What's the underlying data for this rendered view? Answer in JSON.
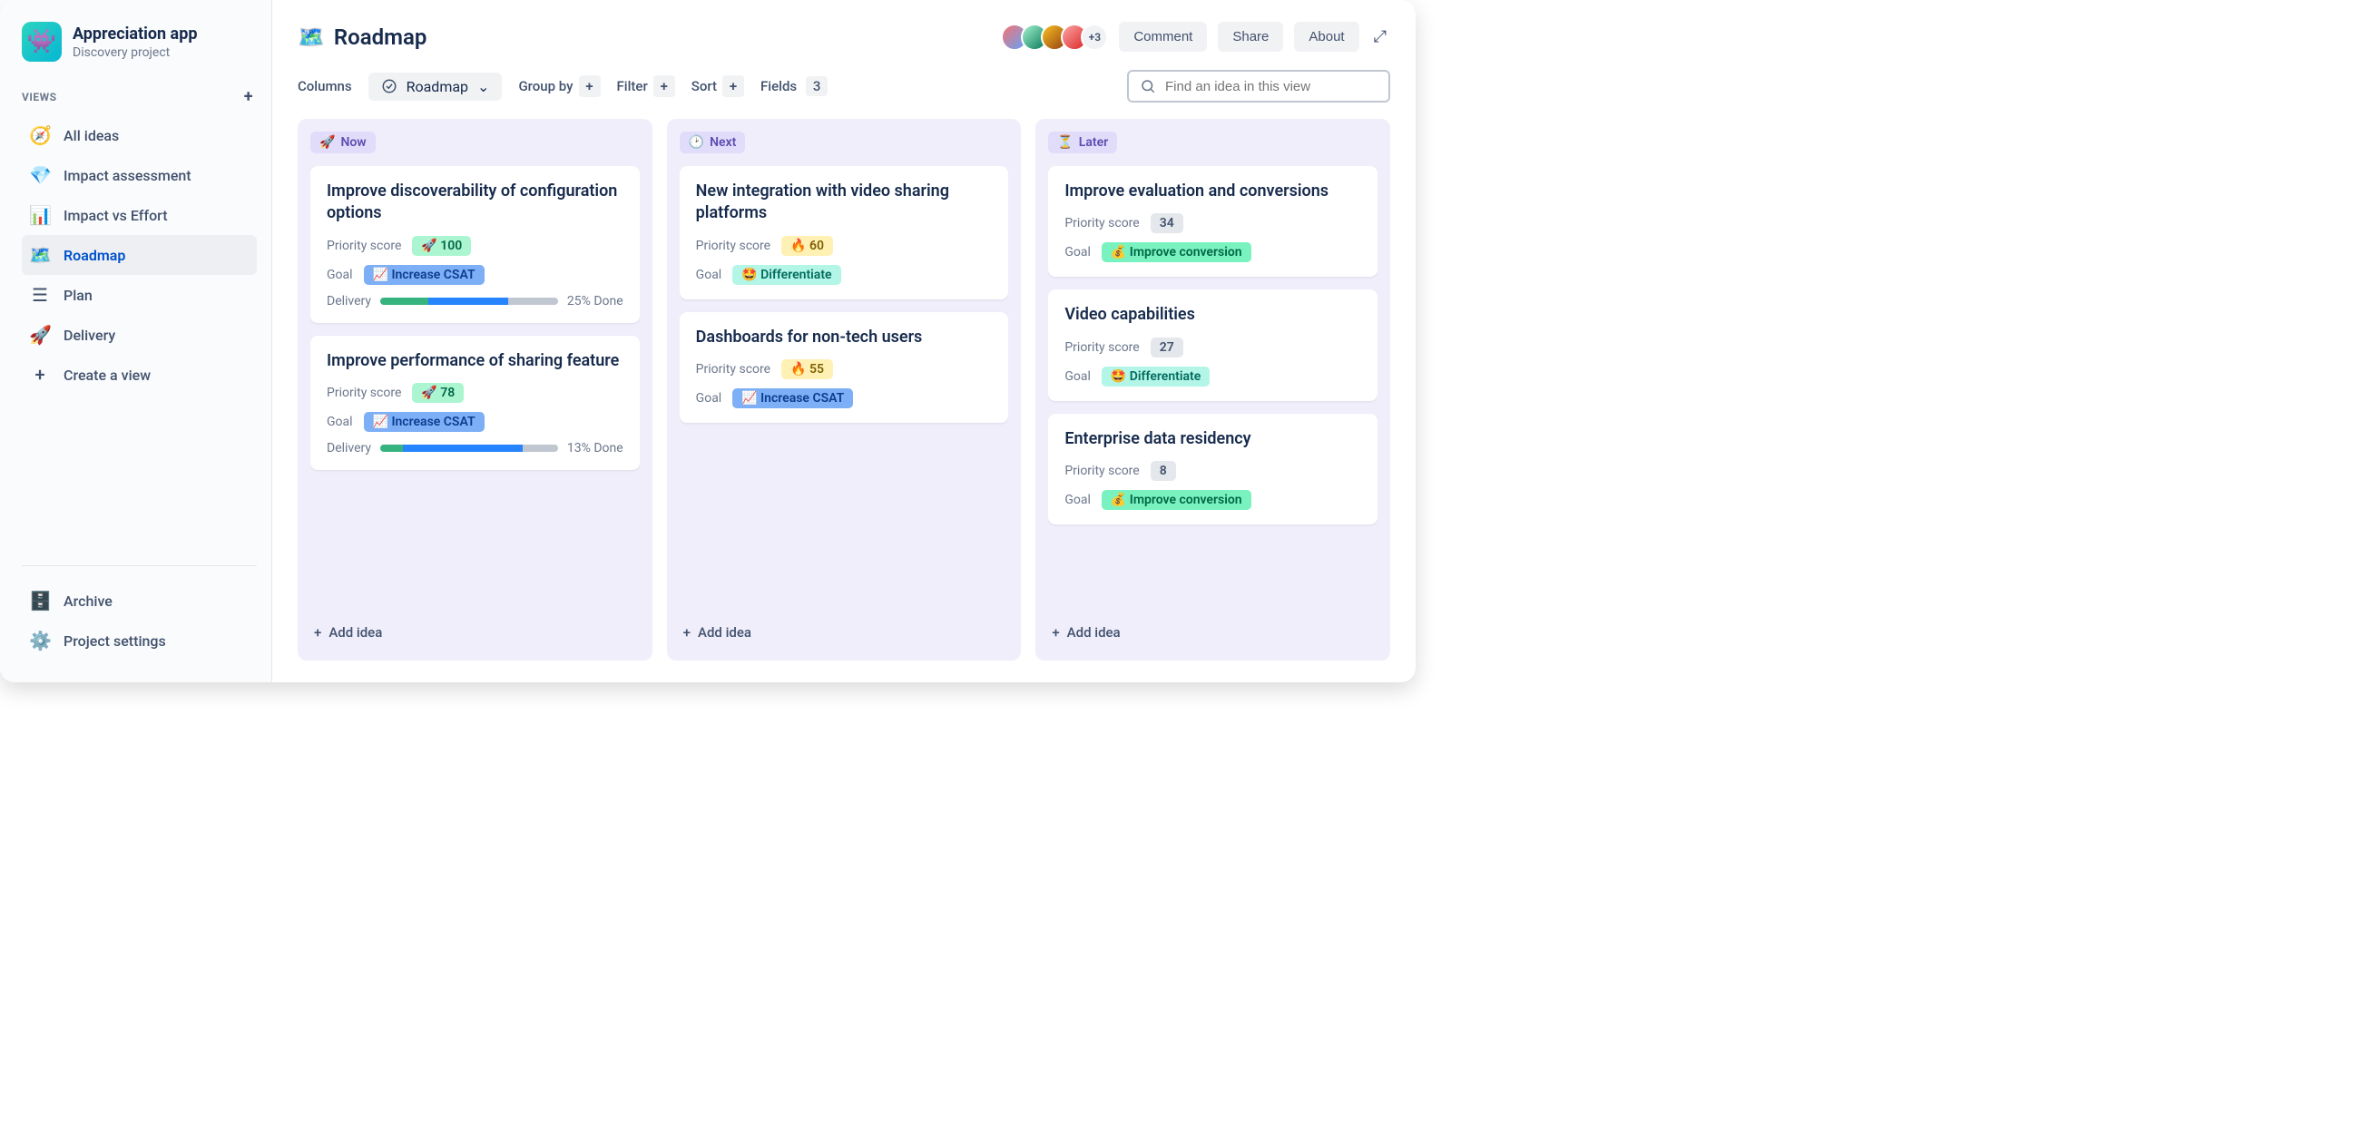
{
  "project": {
    "name": "Appreciation app",
    "subtitle": "Discovery project",
    "logo_emoji": "👾"
  },
  "sidebar": {
    "views_label": "VIEWS",
    "items": [
      {
        "icon": "🧭",
        "label": "All ideas"
      },
      {
        "icon": "💎",
        "label": "Impact assessment"
      },
      {
        "icon": "📊",
        "label": "Impact vs Effort"
      },
      {
        "icon": "🗺️",
        "label": "Roadmap",
        "active": true
      },
      {
        "icon": "☰",
        "label": "Plan"
      },
      {
        "icon": "🚀",
        "label": "Delivery"
      },
      {
        "icon": "+",
        "label": "Create a view"
      }
    ],
    "archive_label": "Archive",
    "settings_label": "Project settings"
  },
  "topbar": {
    "title_emoji": "🗺️",
    "title": "Roadmap",
    "avatars_more": "+3",
    "comment_label": "Comment",
    "share_label": "Share",
    "about_label": "About"
  },
  "toolbar": {
    "columns_label": "Columns",
    "columns_value": "Roadmap",
    "groupby_label": "Group by",
    "filter_label": "Filter",
    "sort_label": "Sort",
    "fields_label": "Fields",
    "fields_count": "3",
    "search_placeholder": "Find an idea in this view"
  },
  "field_labels": {
    "priority": "Priority score",
    "goal": "Goal",
    "delivery": "Delivery"
  },
  "goals": {
    "increase_csat": {
      "emoji": "📈",
      "label": "Increase CSAT",
      "style": "b-blue"
    },
    "differentiate": {
      "emoji": "🤩",
      "label": "Differentiate",
      "style": "b-teal"
    },
    "improve_conversion": {
      "emoji": "💰",
      "label": "Improve conversion",
      "style": "b-mint"
    }
  },
  "board": {
    "add_idea_label": "Add idea",
    "columns": [
      {
        "icon": "🚀",
        "label": "Now",
        "cards": [
          {
            "title": "Improve discoverability of configuration options",
            "priority": {
              "emoji": "🚀",
              "value": "100",
              "style": "b-green"
            },
            "goal": "increase_csat",
            "delivery": {
              "done_label": "25% Done",
              "segments": [
                27,
                45,
                28
              ]
            }
          },
          {
            "title": "Improve performance of sharing feature",
            "priority": {
              "emoji": "🚀",
              "value": "78",
              "style": "b-green"
            },
            "goal": "increase_csat",
            "delivery": {
              "done_label": "13% Done",
              "segments": [
                13,
                67,
                20
              ]
            }
          }
        ]
      },
      {
        "icon": "🕑",
        "label": "Next",
        "cards": [
          {
            "title": "New integration with video sharing platforms",
            "priority": {
              "emoji": "🔥",
              "value": "60",
              "style": "b-orange"
            },
            "goal": "differentiate"
          },
          {
            "title": "Dashboards for non-tech users",
            "priority": {
              "emoji": "🔥",
              "value": "55",
              "style": "b-orange"
            },
            "goal": "increase_csat"
          }
        ]
      },
      {
        "icon": "⏳",
        "label": "Later",
        "cards": [
          {
            "title": "Improve evaluation and conversions",
            "priority": {
              "value": "34",
              "style": "b-gray"
            },
            "goal": "improve_conversion"
          },
          {
            "title": "Video capabilities",
            "priority": {
              "value": "27",
              "style": "b-gray"
            },
            "goal": "differentiate"
          },
          {
            "title": "Enterprise data residency",
            "priority": {
              "value": "8",
              "style": "b-gray"
            },
            "goal": "improve_conversion"
          }
        ]
      }
    ]
  }
}
